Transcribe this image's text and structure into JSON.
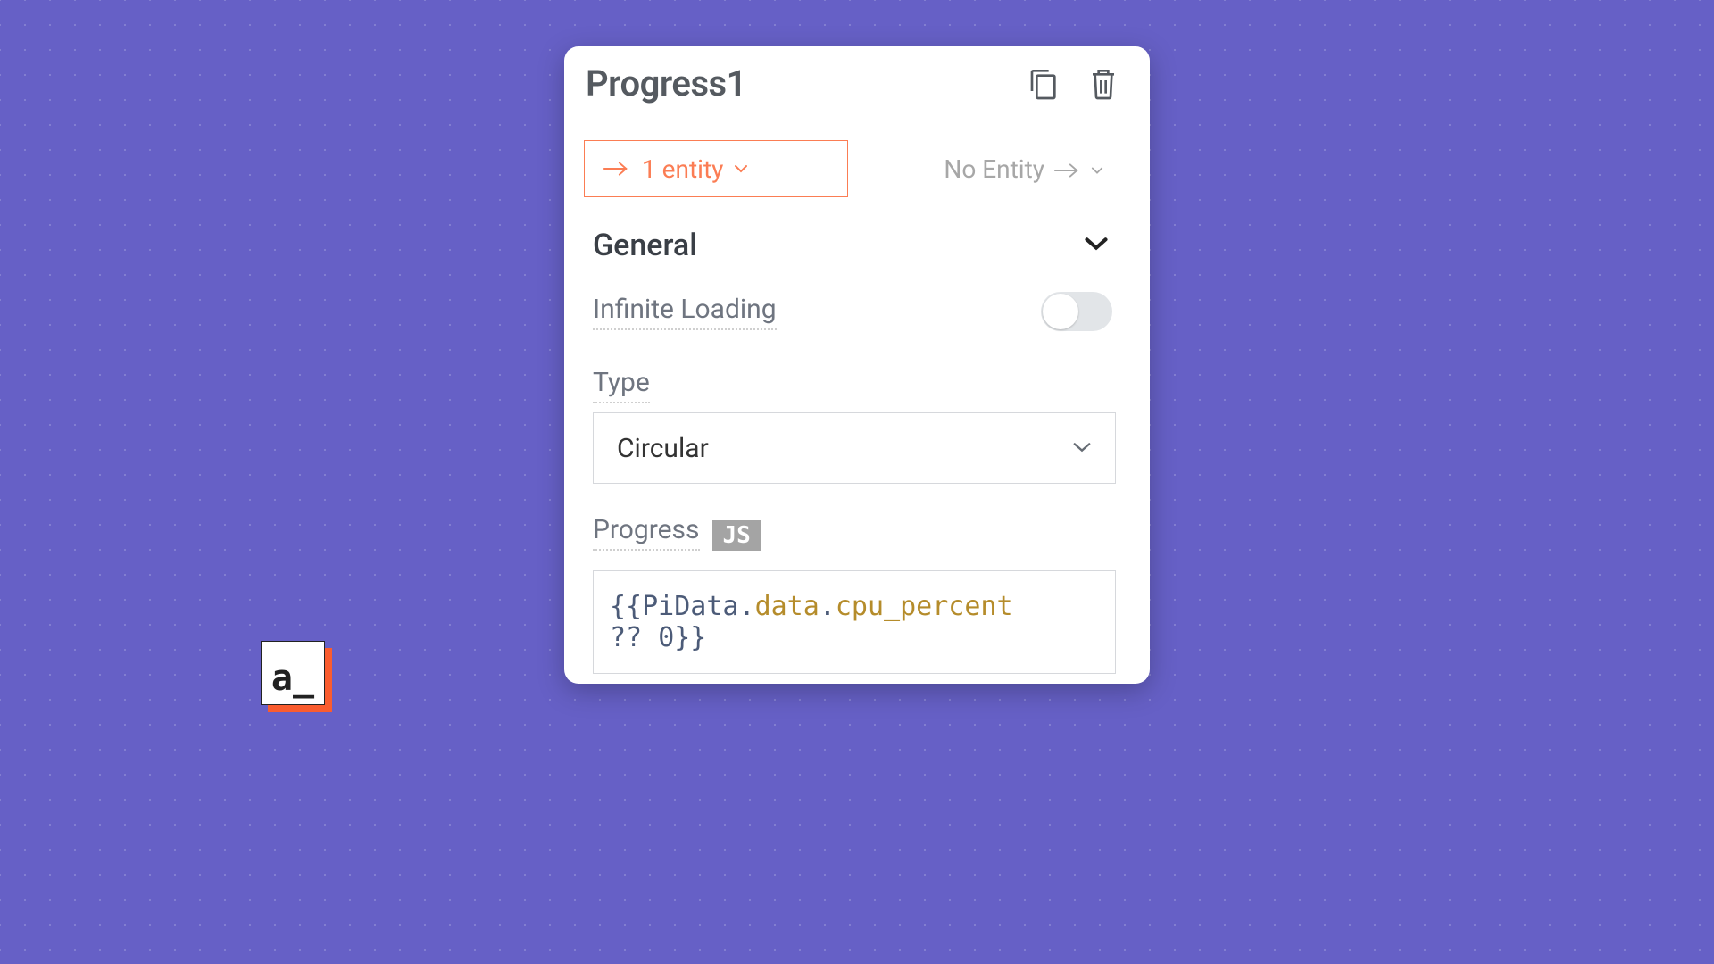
{
  "panel": {
    "title": "Progress1"
  },
  "entityBox": {
    "label": "1 entity"
  },
  "noEntity": {
    "label": "No Entity"
  },
  "section": {
    "title": "General"
  },
  "infinite": {
    "label": "Infinite Loading",
    "enabled": false
  },
  "type": {
    "label": "Type",
    "value": "Circular"
  },
  "progress": {
    "label": "Progress",
    "badge": "JS",
    "code_tokens": {
      "open": "{{",
      "obj": "PiData",
      "dot1": ".",
      "p1": "data",
      "dot2": ".",
      "p2": "cpu_percent",
      "nl": " ",
      "nullish": "??",
      "sp": " ",
      "num": "0",
      "close": "}}"
    }
  },
  "logo": {
    "text": "a_"
  }
}
